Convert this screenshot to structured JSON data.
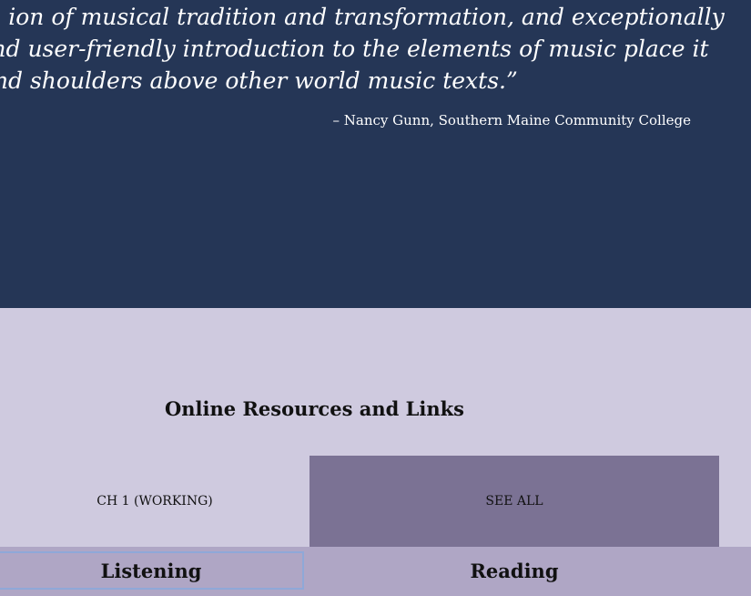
{
  "testimonial": {
    "line1": "ion of musical tradition and transformation, and exceptionally",
    "line2": "nd user-friendly introduction to the elements of music place it",
    "line3": "head and shoulders above other world music texts.”",
    "attribution": "– Nancy Gunn, Southern Maine Community College"
  },
  "resources": {
    "title": "Online Resources and Links",
    "buttons": {
      "ch1": "CH 1 (WORKING)",
      "see_all": "SEE ALL"
    },
    "tabs": {
      "listening": "Listening",
      "reading": "Reading"
    }
  },
  "colors": {
    "hero_bg": "#253656",
    "resources_bg": "#cfcadf",
    "see_all_bg": "#7b7294",
    "tabs_bg": "#afa6c5",
    "active_tab_border": "#8fa8d8"
  }
}
